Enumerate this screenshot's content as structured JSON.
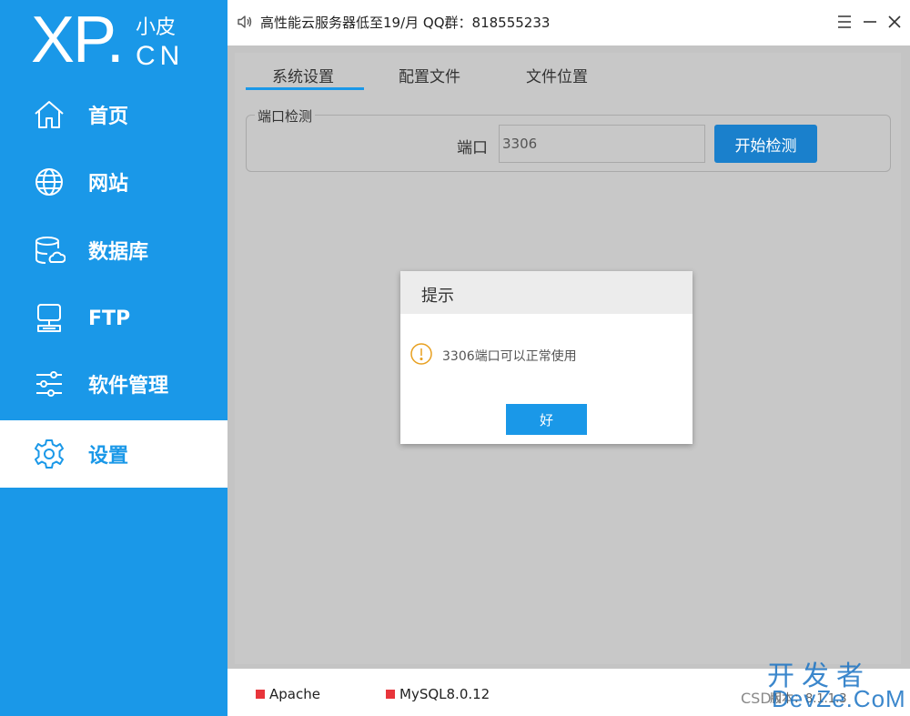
{
  "logo": {
    "big": "XP.",
    "cn": "小皮",
    "sub": "CN"
  },
  "sidebar": {
    "items": [
      {
        "label": "首页",
        "icon": "home-icon"
      },
      {
        "label": "网站",
        "icon": "globe-icon"
      },
      {
        "label": "数据库",
        "icon": "database-icon"
      },
      {
        "label": "FTP",
        "icon": "ftp-icon"
      },
      {
        "label": "软件管理",
        "icon": "sliders-icon"
      },
      {
        "label": "设置",
        "icon": "gear-icon",
        "active": true
      }
    ]
  },
  "topbar": {
    "notice": "高性能云服务器低至19/月  QQ群：818555233"
  },
  "tabs": [
    {
      "label": "系统设置",
      "active": true
    },
    {
      "label": "配置文件"
    },
    {
      "label": "文件位置"
    }
  ],
  "port_check": {
    "legend": "端口检测",
    "label": "端口",
    "value": "3306",
    "button": "开始检测"
  },
  "dialog": {
    "title": "提示",
    "message": "3306端口可以正常使用",
    "ok": "好"
  },
  "status": {
    "apache": "Apache",
    "mysql": "MySQL8.0.12",
    "version": "版本：8.1.1.3"
  },
  "watermark": {
    "top": "开发者",
    "bottom": "DevZe.CoM",
    "csdn": "CSDN"
  },
  "colors": {
    "accent": "#1a98e8",
    "status_stopped": "#e8353b",
    "overlay": "#c4c4c4"
  }
}
